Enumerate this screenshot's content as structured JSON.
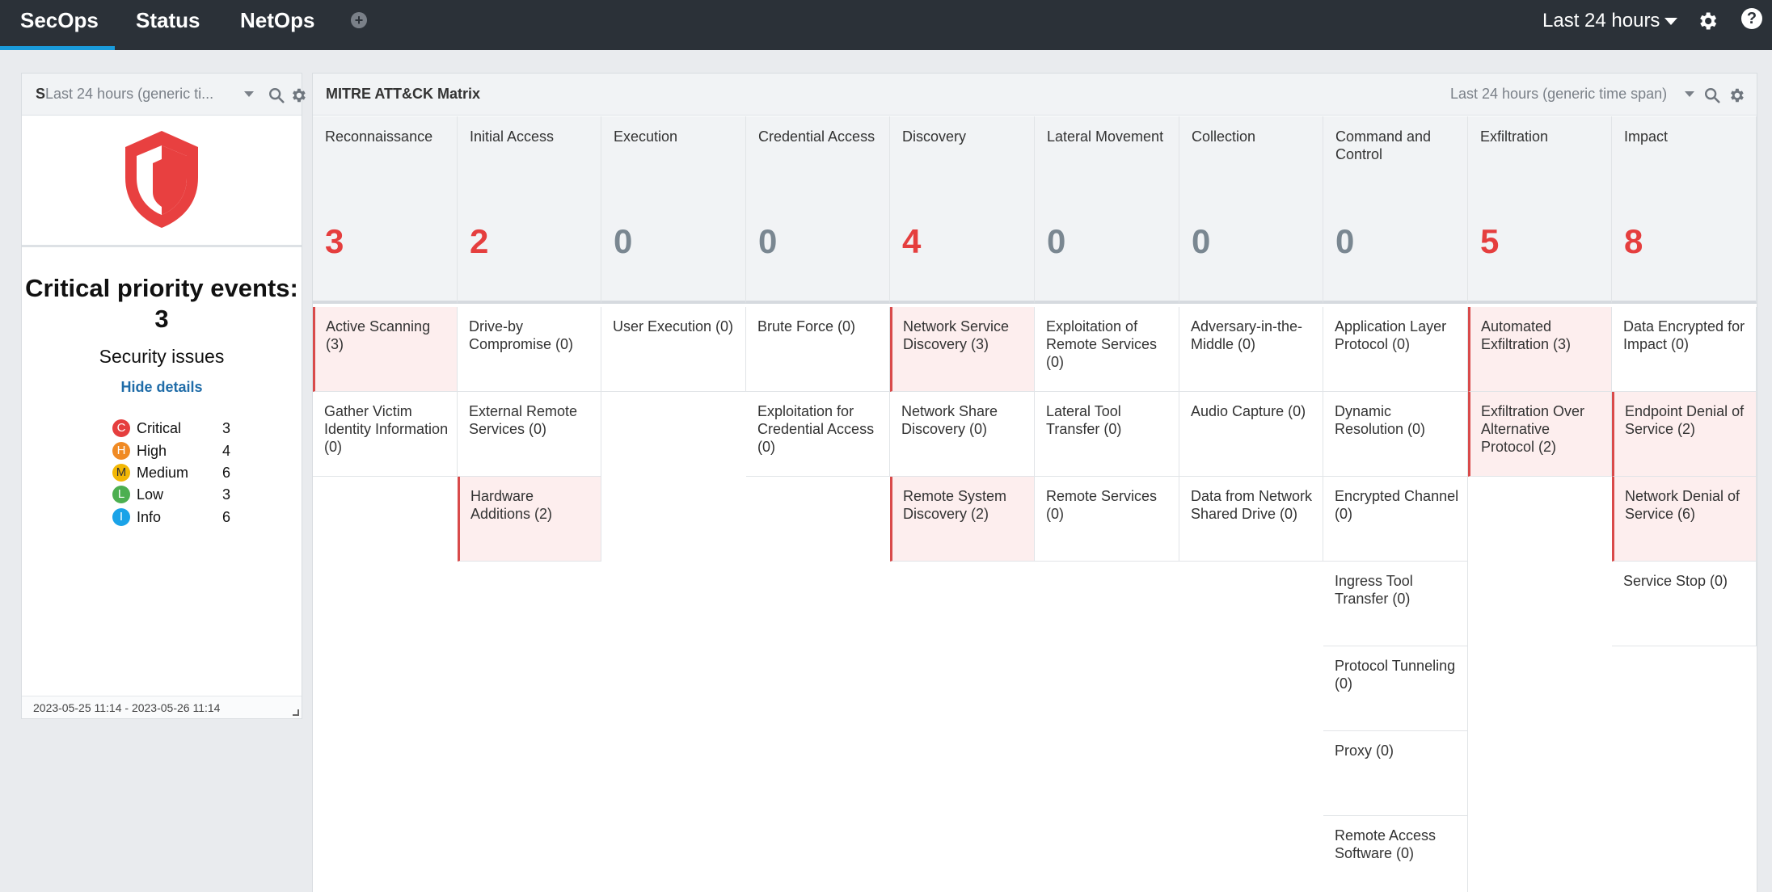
{
  "nav": {
    "tabs": [
      {
        "label": "SecOps"
      },
      {
        "label": "Status"
      },
      {
        "label": "NetOps"
      }
    ],
    "add_tab_symbol": "+",
    "time_range": "Last 24 hours",
    "help_symbol": "?"
  },
  "left_widget": {
    "title_prefix": "S",
    "title_range": "Last 24 hours (generic ti...",
    "headline": "Critical priority events: 3",
    "subtitle": "Security issues",
    "hide_details": "Hide details",
    "legend": [
      {
        "badge": "C",
        "label": "Critical",
        "count": "3",
        "color": "#e53e3e"
      },
      {
        "badge": "H",
        "label": "High",
        "count": "4",
        "color": "#f08a24"
      },
      {
        "badge": "M",
        "label": "Medium",
        "count": "6",
        "color": "#f2b705"
      },
      {
        "badge": "L",
        "label": "Low",
        "count": "3",
        "color": "#4caf50"
      },
      {
        "badge": "I",
        "label": "Info",
        "count": "6",
        "color": "#1aa3e8"
      }
    ],
    "footer": "2023-05-25 11:14 - 2023-05-26 11:14",
    "icons": {
      "shield": "shield-icon",
      "search": "search-icon",
      "gear": "gear-icon"
    }
  },
  "matrix": {
    "title": "MITRE ATT&CK Matrix",
    "range": "Last 24 hours (generic time span)",
    "columns": [
      {
        "name": "Reconnaissance",
        "count": "3",
        "techniques": [
          {
            "label": "Active Scanning (3)",
            "hi": true
          },
          {
            "label": "Gather Victim Identity Information (0)",
            "hi": false
          }
        ]
      },
      {
        "name": "Initial Access",
        "count": "2",
        "techniques": [
          {
            "label": "Drive-by Compromise (0)",
            "hi": false
          },
          {
            "label": "External Remote Services (0)",
            "hi": false
          },
          {
            "label": "Hardware Additions (2)",
            "hi": true
          }
        ]
      },
      {
        "name": "Execution",
        "count": "0",
        "techniques": [
          {
            "label": "User Execution (0)",
            "hi": false
          }
        ]
      },
      {
        "name": "Credential Access",
        "count": "0",
        "techniques": [
          {
            "label": "Brute Force (0)",
            "hi": false
          },
          {
            "label": "Exploitation for Credential Access (0)",
            "hi": false
          }
        ]
      },
      {
        "name": "Discovery",
        "count": "4",
        "techniques": [
          {
            "label": "Network Service Discovery (3)",
            "hi": true
          },
          {
            "label": "Network Share Discovery (0)",
            "hi": false
          },
          {
            "label": "Remote System Discovery (2)",
            "hi": true
          }
        ]
      },
      {
        "name": "Lateral Movement",
        "count": "0",
        "techniques": [
          {
            "label": "Exploitation of Remote Services (0)",
            "hi": false
          },
          {
            "label": "Lateral Tool Transfer (0)",
            "hi": false
          },
          {
            "label": "Remote Services (0)",
            "hi": false
          }
        ]
      },
      {
        "name": "Collection",
        "count": "0",
        "techniques": [
          {
            "label": "Adversary-in-the-Middle (0)",
            "hi": false
          },
          {
            "label": "Audio Capture (0)",
            "hi": false
          },
          {
            "label": "Data from Network Shared Drive (0)",
            "hi": false
          }
        ]
      },
      {
        "name": "Command and Control",
        "count": "0",
        "techniques": [
          {
            "label": "Application Layer Protocol (0)",
            "hi": false
          },
          {
            "label": "Dynamic Resolution (0)",
            "hi": false
          },
          {
            "label": "Encrypted Channel (0)",
            "hi": false
          },
          {
            "label": "Ingress Tool Transfer (0)",
            "hi": false
          },
          {
            "label": "Protocol Tunneling (0)",
            "hi": false
          },
          {
            "label": "Proxy (0)",
            "hi": false
          },
          {
            "label": "Remote Access Software (0)",
            "hi": false
          }
        ]
      },
      {
        "name": "Exfiltration",
        "count": "5",
        "techniques": [
          {
            "label": "Automated Exfiltration (3)",
            "hi": true
          },
          {
            "label": "Exfiltration Over Alternative Protocol (2)",
            "hi": true
          }
        ]
      },
      {
        "name": "Impact",
        "count": "8",
        "techniques": [
          {
            "label": "Data Encrypted for Impact (0)",
            "hi": false
          },
          {
            "label": "Endpoint Denial of Service (2)",
            "hi": true
          },
          {
            "label": "Network Denial of Service (6)",
            "hi": true
          },
          {
            "label": "Service Stop (0)",
            "hi": false
          }
        ]
      }
    ]
  }
}
